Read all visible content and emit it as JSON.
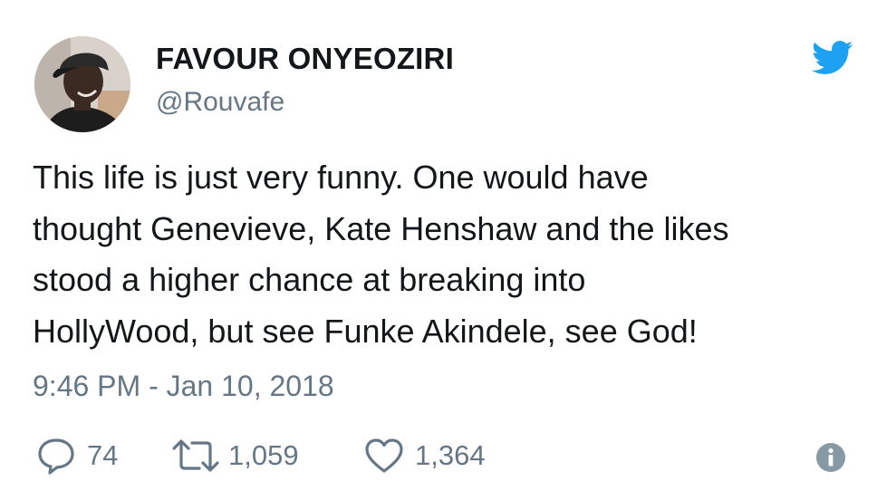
{
  "author": {
    "name": "FAVOUR ONYEOZIRI",
    "handle": "@Rouvafe"
  },
  "tweet": {
    "lines": [
      "This life is just very funny. One would have",
      "thought Genevieve, Kate Henshaw and the likes",
      "stood a higher chance at breaking into",
      "HollyWood, but see Funke Akindele, see God!"
    ],
    "timestamp": "9:46 PM - Jan 10, 2018"
  },
  "actions": {
    "replies": "74",
    "retweets": "1,059",
    "likes": "1,364"
  },
  "icons": {
    "brand": "twitter-bird-icon",
    "reply": "reply-icon",
    "retweet": "retweet-icon",
    "like": "heart-icon",
    "info": "info-icon"
  },
  "colors": {
    "twitter_blue": "#1da1f2",
    "secondary_text": "#657786",
    "primary_text": "#14171a"
  }
}
